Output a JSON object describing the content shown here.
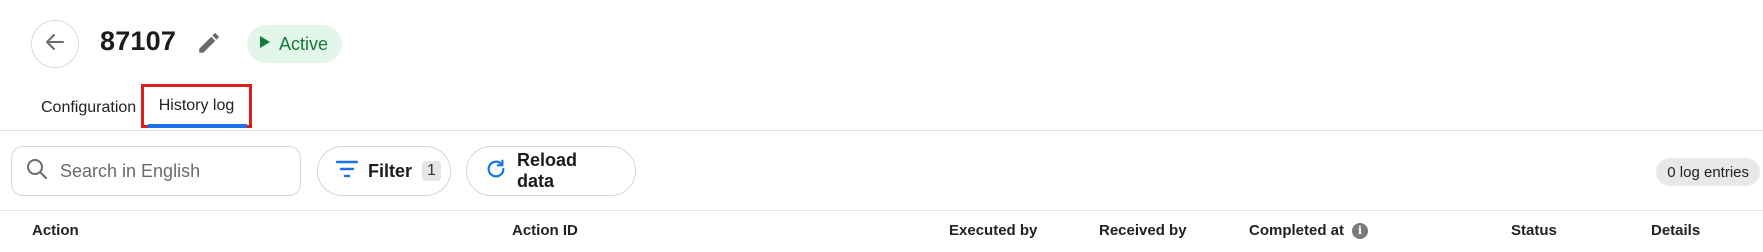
{
  "header": {
    "title": "87107",
    "status": "Active"
  },
  "tabs": [
    {
      "label": "Configuration"
    },
    {
      "label": "History log"
    }
  ],
  "toolbar": {
    "search_placeholder": "Search in English",
    "filter_label": "Filter",
    "filter_count": "1",
    "reload_label": "Reload data",
    "entries_label": "0 log entries"
  },
  "table": {
    "columns": [
      "Action",
      "Action ID",
      "Executed by",
      "Received by",
      "Completed at",
      "Status",
      "Details"
    ]
  },
  "colors": {
    "accent": "#1a73e8",
    "status_bg": "#e3f6ea",
    "status_text": "#137a3a",
    "highlight": "#d9201f"
  }
}
